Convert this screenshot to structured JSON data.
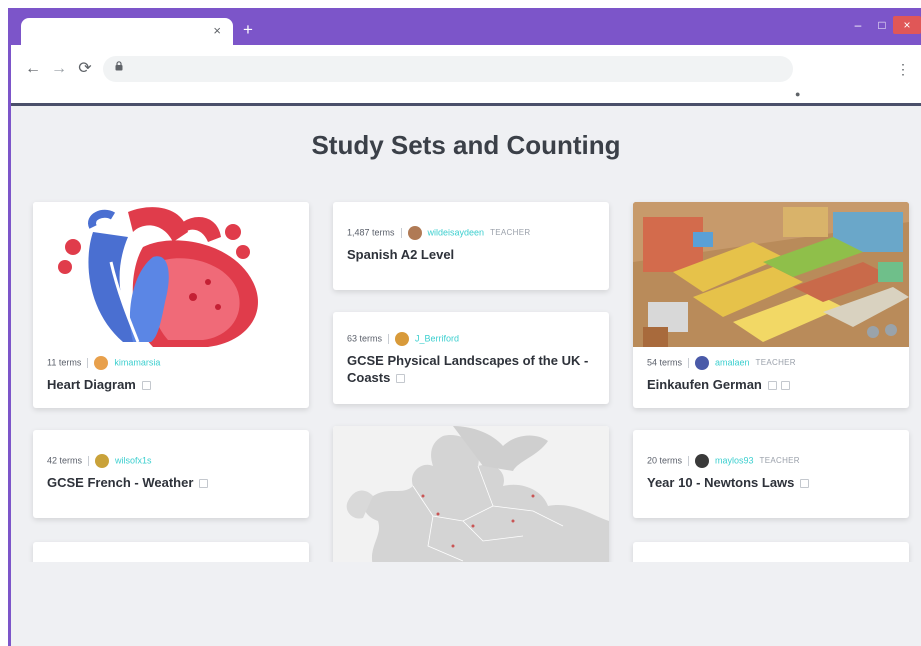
{
  "browser": {
    "tab_close": "×",
    "new_tab": "+",
    "window_controls": {
      "minimize": "–",
      "maximize": "□",
      "close": "×"
    },
    "nav": {
      "back": "←",
      "forward": "→",
      "reload": "⟳"
    },
    "lock_icon": "lock-icon",
    "menu": "⋮",
    "extension": "●",
    "accent_color": "#7c55c9"
  },
  "page": {
    "heading": "Study Sets and Counting",
    "accent_teal": "#3ccfcf",
    "cards": [
      {
        "terms": "11 terms",
        "user": "kimamarsia",
        "role": "",
        "title": "Heart Diagram",
        "image": "heart-illustration"
      },
      {
        "terms": "1,487 terms",
        "user": "wildeisaydeen",
        "role": "TEACHER",
        "title": "Spanish A2 Level"
      },
      {
        "terms": "54 terms",
        "user": "amalaen",
        "role": "TEACHER",
        "title": "Einkaufen German",
        "image": "supermarket-illustration"
      },
      {
        "terms": "63 terms",
        "user": "J_Berriford",
        "role": "",
        "title": "GCSE Physical Landscapes of the UK - Coasts"
      },
      {
        "terms": "42 terms",
        "user": "wilsofx1s",
        "role": "",
        "title": "GCSE French - Weather"
      },
      {
        "terms": "",
        "user": "",
        "role": "",
        "title": "",
        "image": "europe-map"
      },
      {
        "terms": "20 terms",
        "user": "maylos93",
        "role": "TEACHER",
        "title": "Year 10 - Newtons Laws"
      }
    ]
  }
}
